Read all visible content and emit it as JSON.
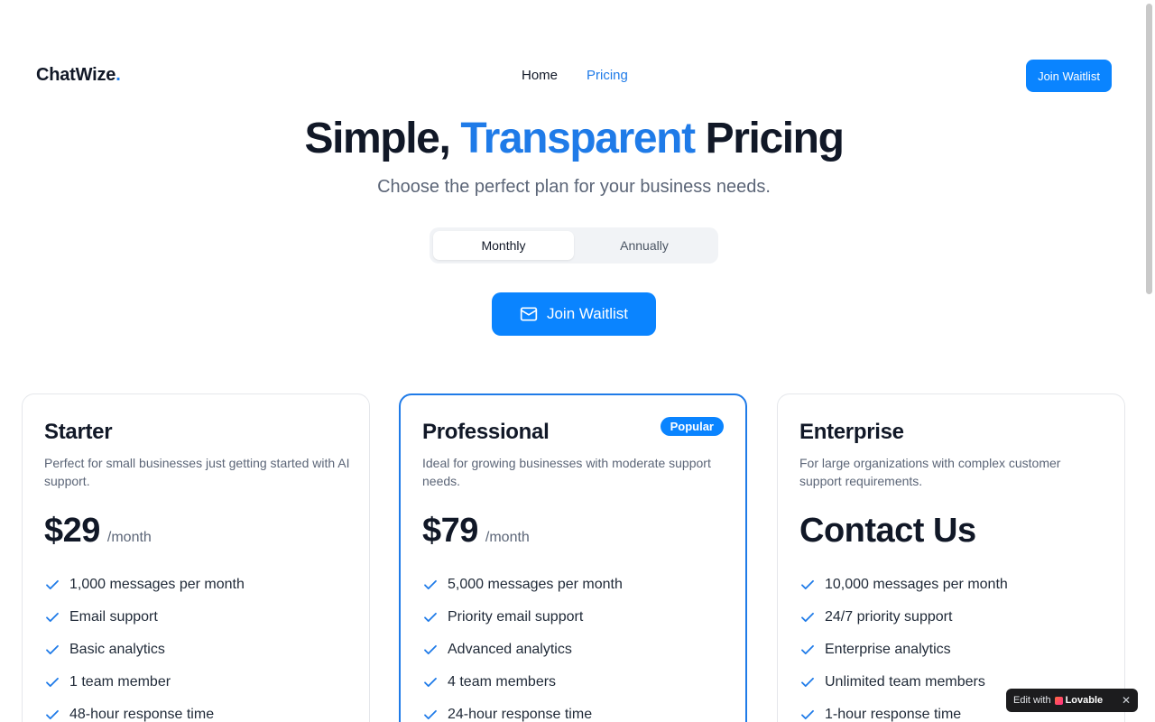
{
  "nav": {
    "logo_text": "ChatWize",
    "logo_dot": ".",
    "links": [
      {
        "label": "Home",
        "active": false
      },
      {
        "label": "Pricing",
        "active": true
      }
    ],
    "cta_label": "Join Waitlist"
  },
  "hero": {
    "title_part1": "Simple, ",
    "title_accent": "Transparent",
    "title_part2": " Pricing",
    "subtitle": "Choose the perfect plan for your business needs."
  },
  "billing_toggle": {
    "options": [
      "Monthly",
      "Annually"
    ],
    "selected": "Monthly"
  },
  "cta": {
    "label": "Join Waitlist",
    "icon": "mail-icon"
  },
  "plans": [
    {
      "name": "Starter",
      "description": "Perfect for small businesses just getting started with AI support.",
      "price": "$29",
      "unit": "/month",
      "popular": false,
      "features": [
        "1,000 messages per month",
        "Email support",
        "Basic analytics",
        "1 team member",
        "48-hour response time"
      ]
    },
    {
      "name": "Professional",
      "description": "Ideal for growing businesses with moderate support needs.",
      "price": "$79",
      "unit": "/month",
      "popular": true,
      "badge": "Popular",
      "features": [
        "5,000 messages per month",
        "Priority email support",
        "Advanced analytics",
        "4 team members",
        "24-hour response time"
      ]
    },
    {
      "name": "Enterprise",
      "description": "For large organizations with complex customer support requirements.",
      "price": "Contact Us",
      "unit": "",
      "popular": false,
      "features": [
        "10,000 messages per month",
        "24/7 priority support",
        "Enterprise analytics",
        "Unlimited team members",
        "1-hour response time"
      ]
    }
  ],
  "lovable_badge": {
    "prefix": "Edit with",
    "brand": "Lovable",
    "close": "✕"
  },
  "colors": {
    "accent": "#1f7be8",
    "button": "#0a84ff",
    "text": "#111827",
    "muted": "#5b6577"
  }
}
